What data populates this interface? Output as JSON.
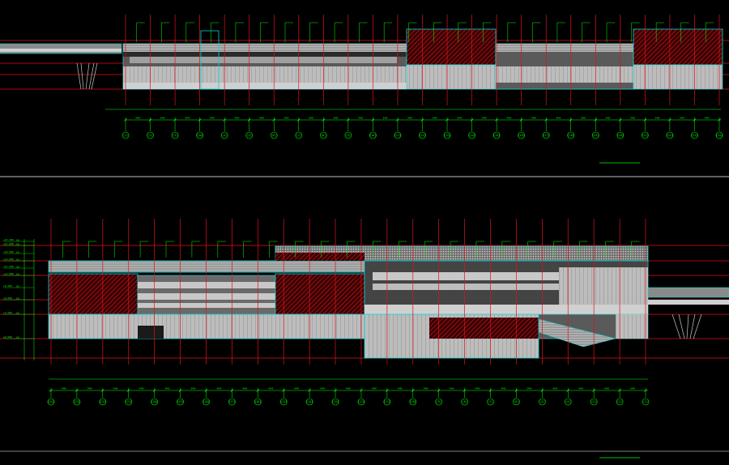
{
  "drawing": {
    "colors": {
      "background": "#000000",
      "gridline": "#e0121b",
      "outline": "#00d8d8",
      "wall": "#c8c8c8",
      "glass": "#8a8a8a",
      "hatch": "#d0202a",
      "dimension": "#00ff00",
      "white": "#ffffff"
    },
    "elevation_1": {
      "title": "",
      "scale_note": "",
      "axis_labels": [
        "(1)",
        "(2)",
        "(3)",
        "(3a)",
        "(4)",
        "(5)",
        "(6)",
        "(7)",
        "(8)",
        "(9)",
        "(10)",
        "(11)",
        "(12)",
        "(13)",
        "(14)",
        "(15)",
        "(16)",
        "(17)",
        "(18)",
        "(19)",
        "(20)",
        "(21)",
        "(22)",
        "(23)",
        "(24)"
      ],
      "dimension_values": [
        "8400",
        "8400",
        "8400",
        "8400",
        "8400",
        "8400",
        "8400",
        "8400",
        "8400",
        "8400",
        "8400",
        "8400",
        "8400",
        "8400",
        "8400",
        "8400",
        "8400",
        "8400",
        "8400",
        "8400",
        "8400",
        "8400",
        "8400",
        "8400"
      ]
    },
    "elevation_2": {
      "title": "",
      "scale_note": "",
      "axis_labels": [
        "(24)",
        "(23)",
        "(22)",
        "(21)",
        "(20)",
        "(19)",
        "(18)",
        "(17)",
        "(16)",
        "(15)",
        "(14)",
        "(13)",
        "(12)",
        "(11)",
        "(10)",
        "(9)",
        "(8)",
        "(7)",
        "(6)",
        "(5)",
        "(4)",
        "(3)",
        "(2)",
        "(1)"
      ],
      "dimension_values": [
        "8400",
        "8400",
        "8400",
        "8400",
        "8400",
        "8400",
        "8400",
        "8400",
        "8400",
        "8400",
        "8400",
        "8400",
        "8400",
        "8400",
        "8400",
        "8400",
        "8400",
        "8400",
        "8400",
        "8400",
        "8400",
        "8400",
        "8400"
      ],
      "level_marks": [
        "+23.500",
        "+21.000",
        "+18.500",
        "+16.000",
        "+13.500",
        "+11.000",
        "+8.500",
        "+6.000",
        "+3.500",
        "±0.000"
      ]
    }
  }
}
